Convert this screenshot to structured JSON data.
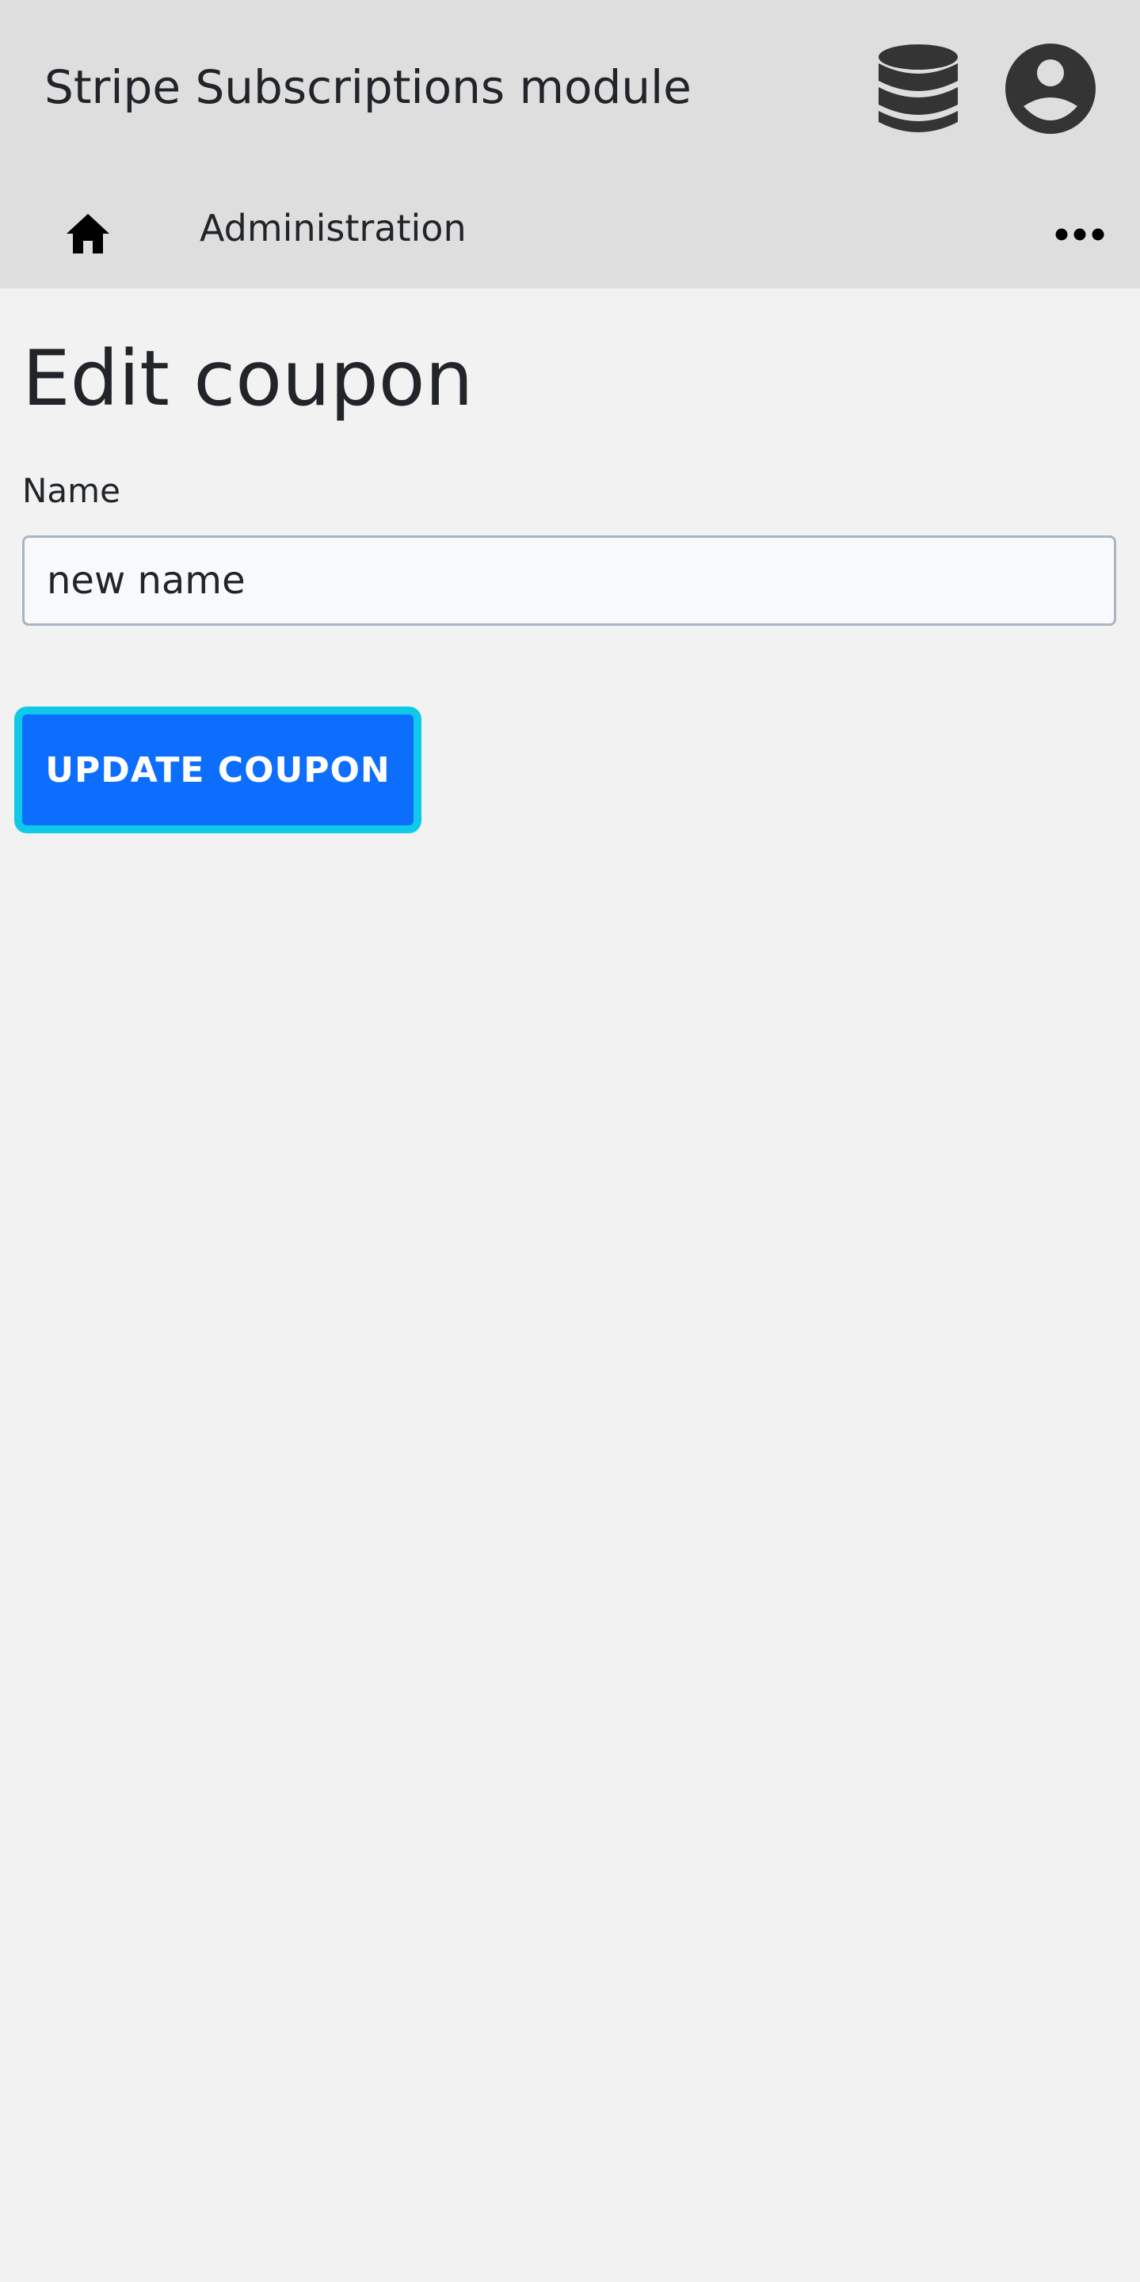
{
  "header": {
    "app_title": "Stripe Subscriptions module",
    "database_icon": "database-icon",
    "account_icon": "account-circle-icon"
  },
  "nav": {
    "home_icon": "home-icon",
    "link_label": "Administration",
    "more_icon": "more-horizontal-icon"
  },
  "main": {
    "page_title": "Edit coupon",
    "name_label": "Name",
    "name_value": "new name",
    "submit_label": "UPDATE COUPON"
  },
  "colors": {
    "header_bg": "#dedede",
    "page_bg": "#f2f2f2",
    "primary_button": "#0d6efd",
    "focus_ring": "#10c8e8"
  }
}
